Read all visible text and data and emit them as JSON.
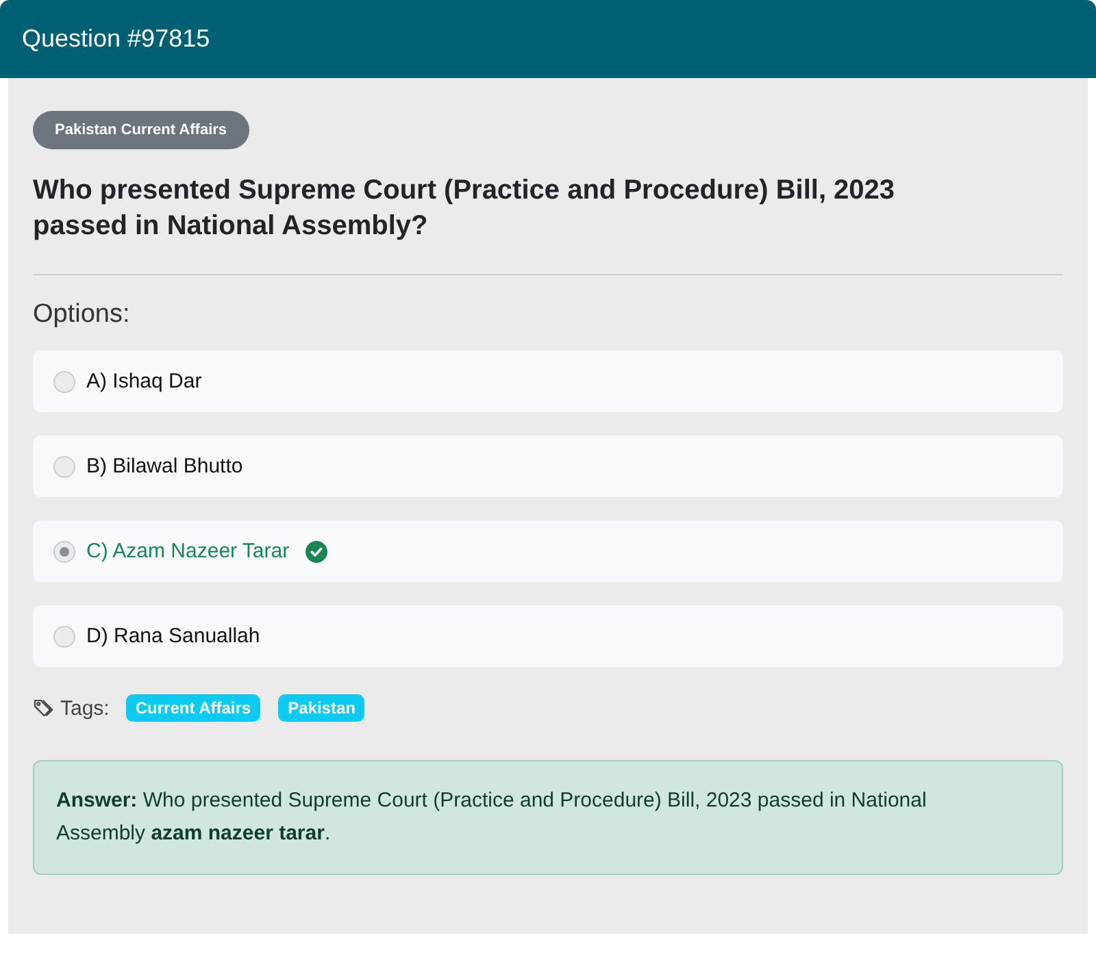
{
  "header": {
    "title": "Question #97815"
  },
  "question": {
    "category": "Pakistan Current Affairs",
    "text": "Who presented Supreme Court (Practice and Procedure) Bill, 2023 passed in National Assembly?"
  },
  "options_label": "Options:",
  "options": [
    {
      "label": "A) Ishaq Dar",
      "selected": false,
      "correct": false
    },
    {
      "label": "B) Bilawal Bhutto",
      "selected": false,
      "correct": false
    },
    {
      "label": "C) Azam Nazeer Tarar",
      "selected": true,
      "correct": true
    },
    {
      "label": "D) Rana Sanuallah",
      "selected": false,
      "correct": false
    }
  ],
  "tags": {
    "label": "Tags:",
    "items": [
      "Current Affairs",
      "Pakistan"
    ]
  },
  "answer": {
    "text": "**Answer:** Who presented Supreme Court (Practice and Procedure) Bill, 2023 passed in National Assembly **azam nazeer tarar**."
  }
}
